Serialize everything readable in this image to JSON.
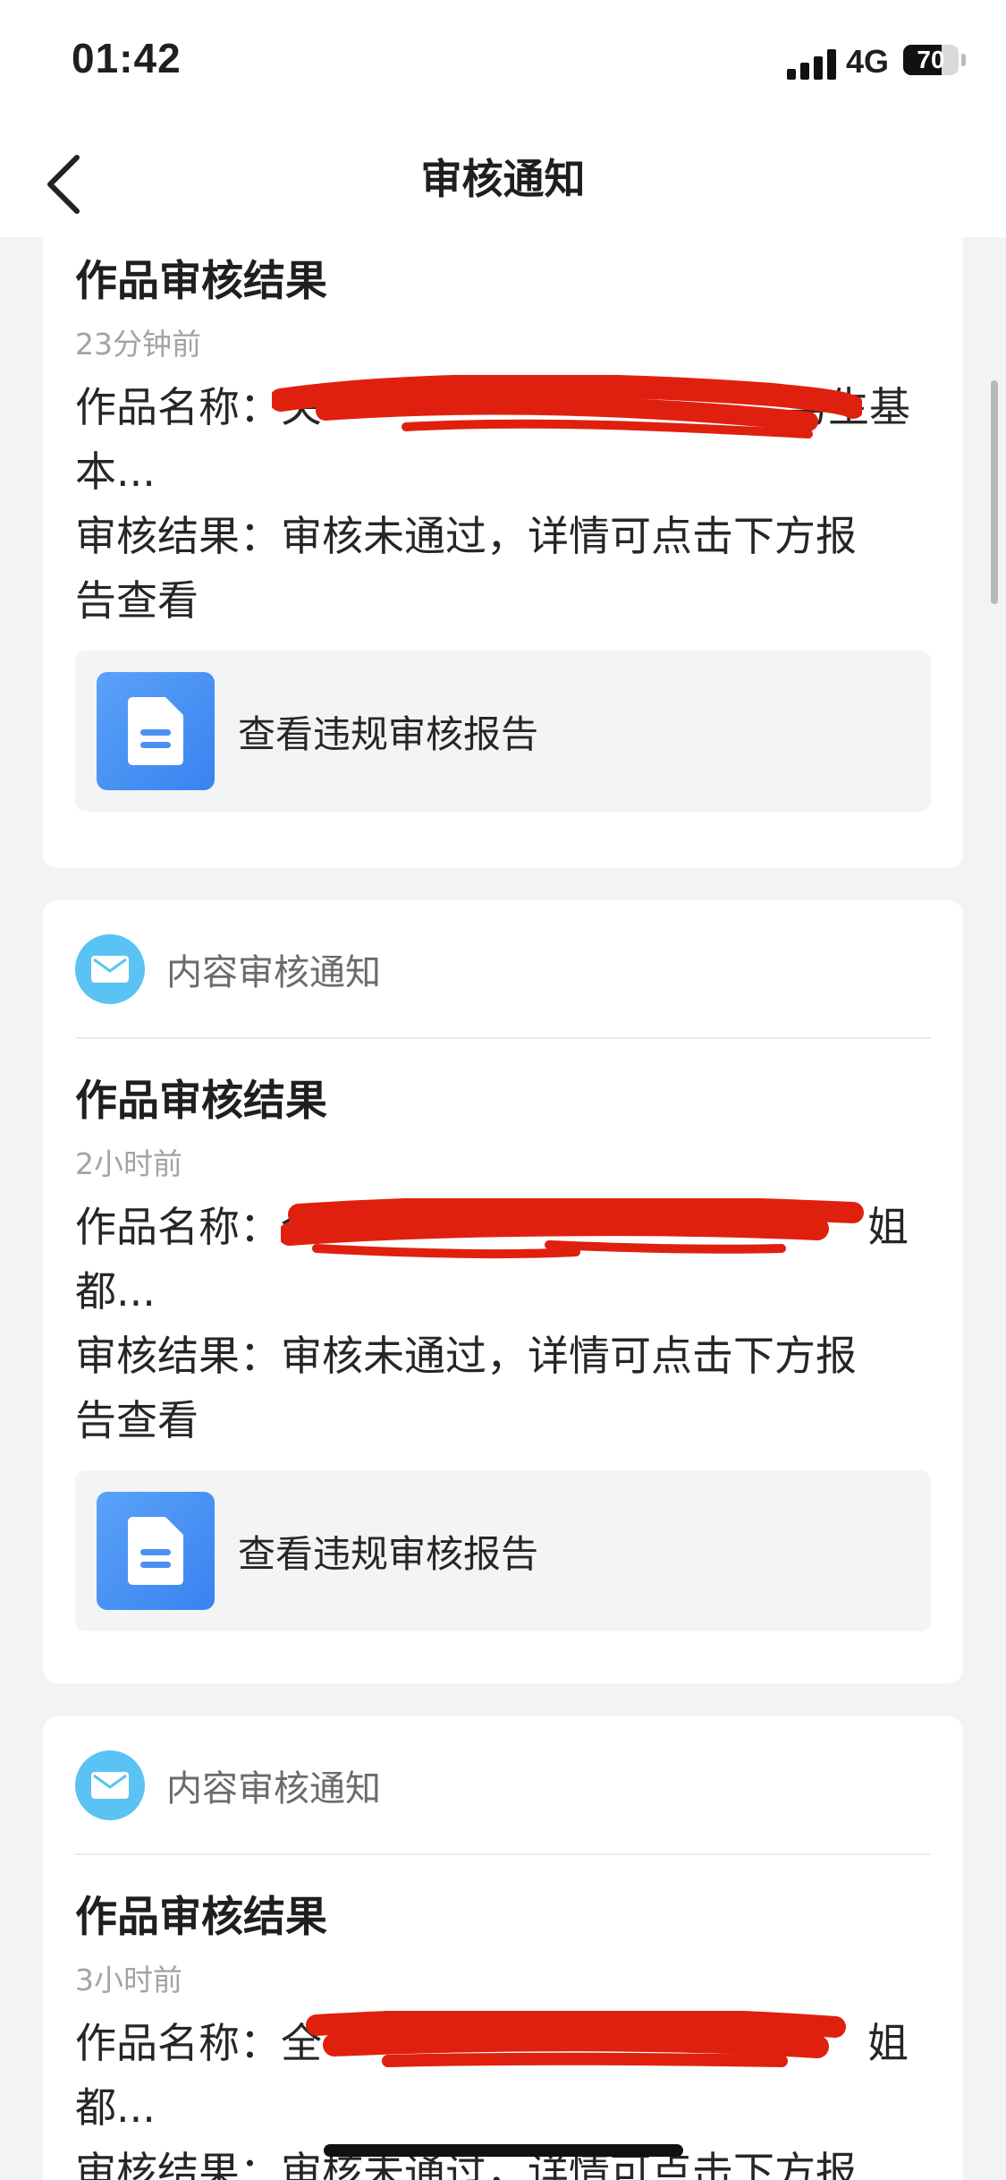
{
  "status_bar": {
    "time": "01:42",
    "network": "4G",
    "battery_percent": 70,
    "battery_text": "70"
  },
  "nav": {
    "title": "审核通知",
    "back_icon": "chevron-left-icon"
  },
  "cards": [
    {
      "category": "",
      "title": "作品审核结果",
      "time": "23分钟前",
      "name_label": "作品名称：",
      "name_visible_start": "关",
      "name_visible_end": "男生基",
      "name_wrap": "本...",
      "result_label": "审核结果：",
      "result_text": "审核未通过，详情可点击下方报",
      "result_wrap": "告查看",
      "report_label": "查看违规审核报告"
    },
    {
      "category": "内容审核通知",
      "title": "作品审核结果",
      "time": "2小时前",
      "name_label": "作品名称：",
      "name_visible_start": "全",
      "name_visible_end": "姐",
      "name_wrap": "都...",
      "result_label": "审核结果：",
      "result_text": "审核未通过，详情可点击下方报",
      "result_wrap": "告查看",
      "report_label": "查看违规审核报告"
    },
    {
      "category": "内容审核通知",
      "title": "作品审核结果",
      "time": "3小时前",
      "name_label": "作品名称：",
      "name_visible_start": "全",
      "name_visible_end": "姐",
      "name_wrap": "都...",
      "result_label": "审核结果：",
      "result_text": "审核未通过，详情可点击下方报"
    }
  ],
  "icons": {
    "mail": "mail-icon",
    "document": "document-icon"
  },
  "colors": {
    "redaction": "#e0200f",
    "mail_icon_bg": "#5ac3f3",
    "doc_icon_bg": "#4a90f5"
  }
}
